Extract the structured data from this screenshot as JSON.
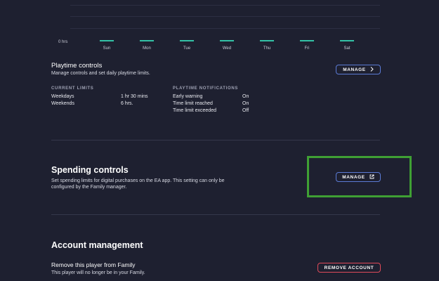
{
  "chart_data": {
    "type": "bar",
    "categories": [
      "Sun",
      "Mon",
      "Tue",
      "Wed",
      "Thu",
      "Fri",
      "Sat"
    ],
    "values": [
      0,
      0,
      0,
      0,
      0,
      0,
      0
    ],
    "ylabel_tick": "0 hrs",
    "accent": "#33c2a6"
  },
  "playtime": {
    "title": "Playtime controls",
    "description": "Manage controls and set daily playtime limits.",
    "manage_label": "MANAGE",
    "current_limits_header": "CURRENT LIMITS",
    "limits": [
      {
        "label": "Weekdays",
        "value": "1 hr 30 mins"
      },
      {
        "label": "Weekends",
        "value": "6 hrs."
      }
    ],
    "notifications_header": "PLAYTIME NOTIFICATIONS",
    "notifications": [
      {
        "label": "Early warning",
        "value": "On"
      },
      {
        "label": "Time limit reached",
        "value": "On"
      },
      {
        "label": "Time limit exceeded",
        "value": "Off"
      }
    ]
  },
  "spending": {
    "title": "Spending controls",
    "description_line1": "Set spending limits for digital purchases on the EA app. This setting can only be",
    "description_line2": "configured by the Family manager.",
    "manage_label": "MANAGE"
  },
  "account": {
    "title": "Account management",
    "remove_title": "Remove this player from Family",
    "remove_desc": "This player will no longer be in your Family.",
    "remove_label": "REMOVE ACCOUNT"
  },
  "colors": {
    "background": "#1e2030",
    "blue_button": "#5b7bd5",
    "red_button": "#e04a5a",
    "highlight": "#3fa034"
  }
}
